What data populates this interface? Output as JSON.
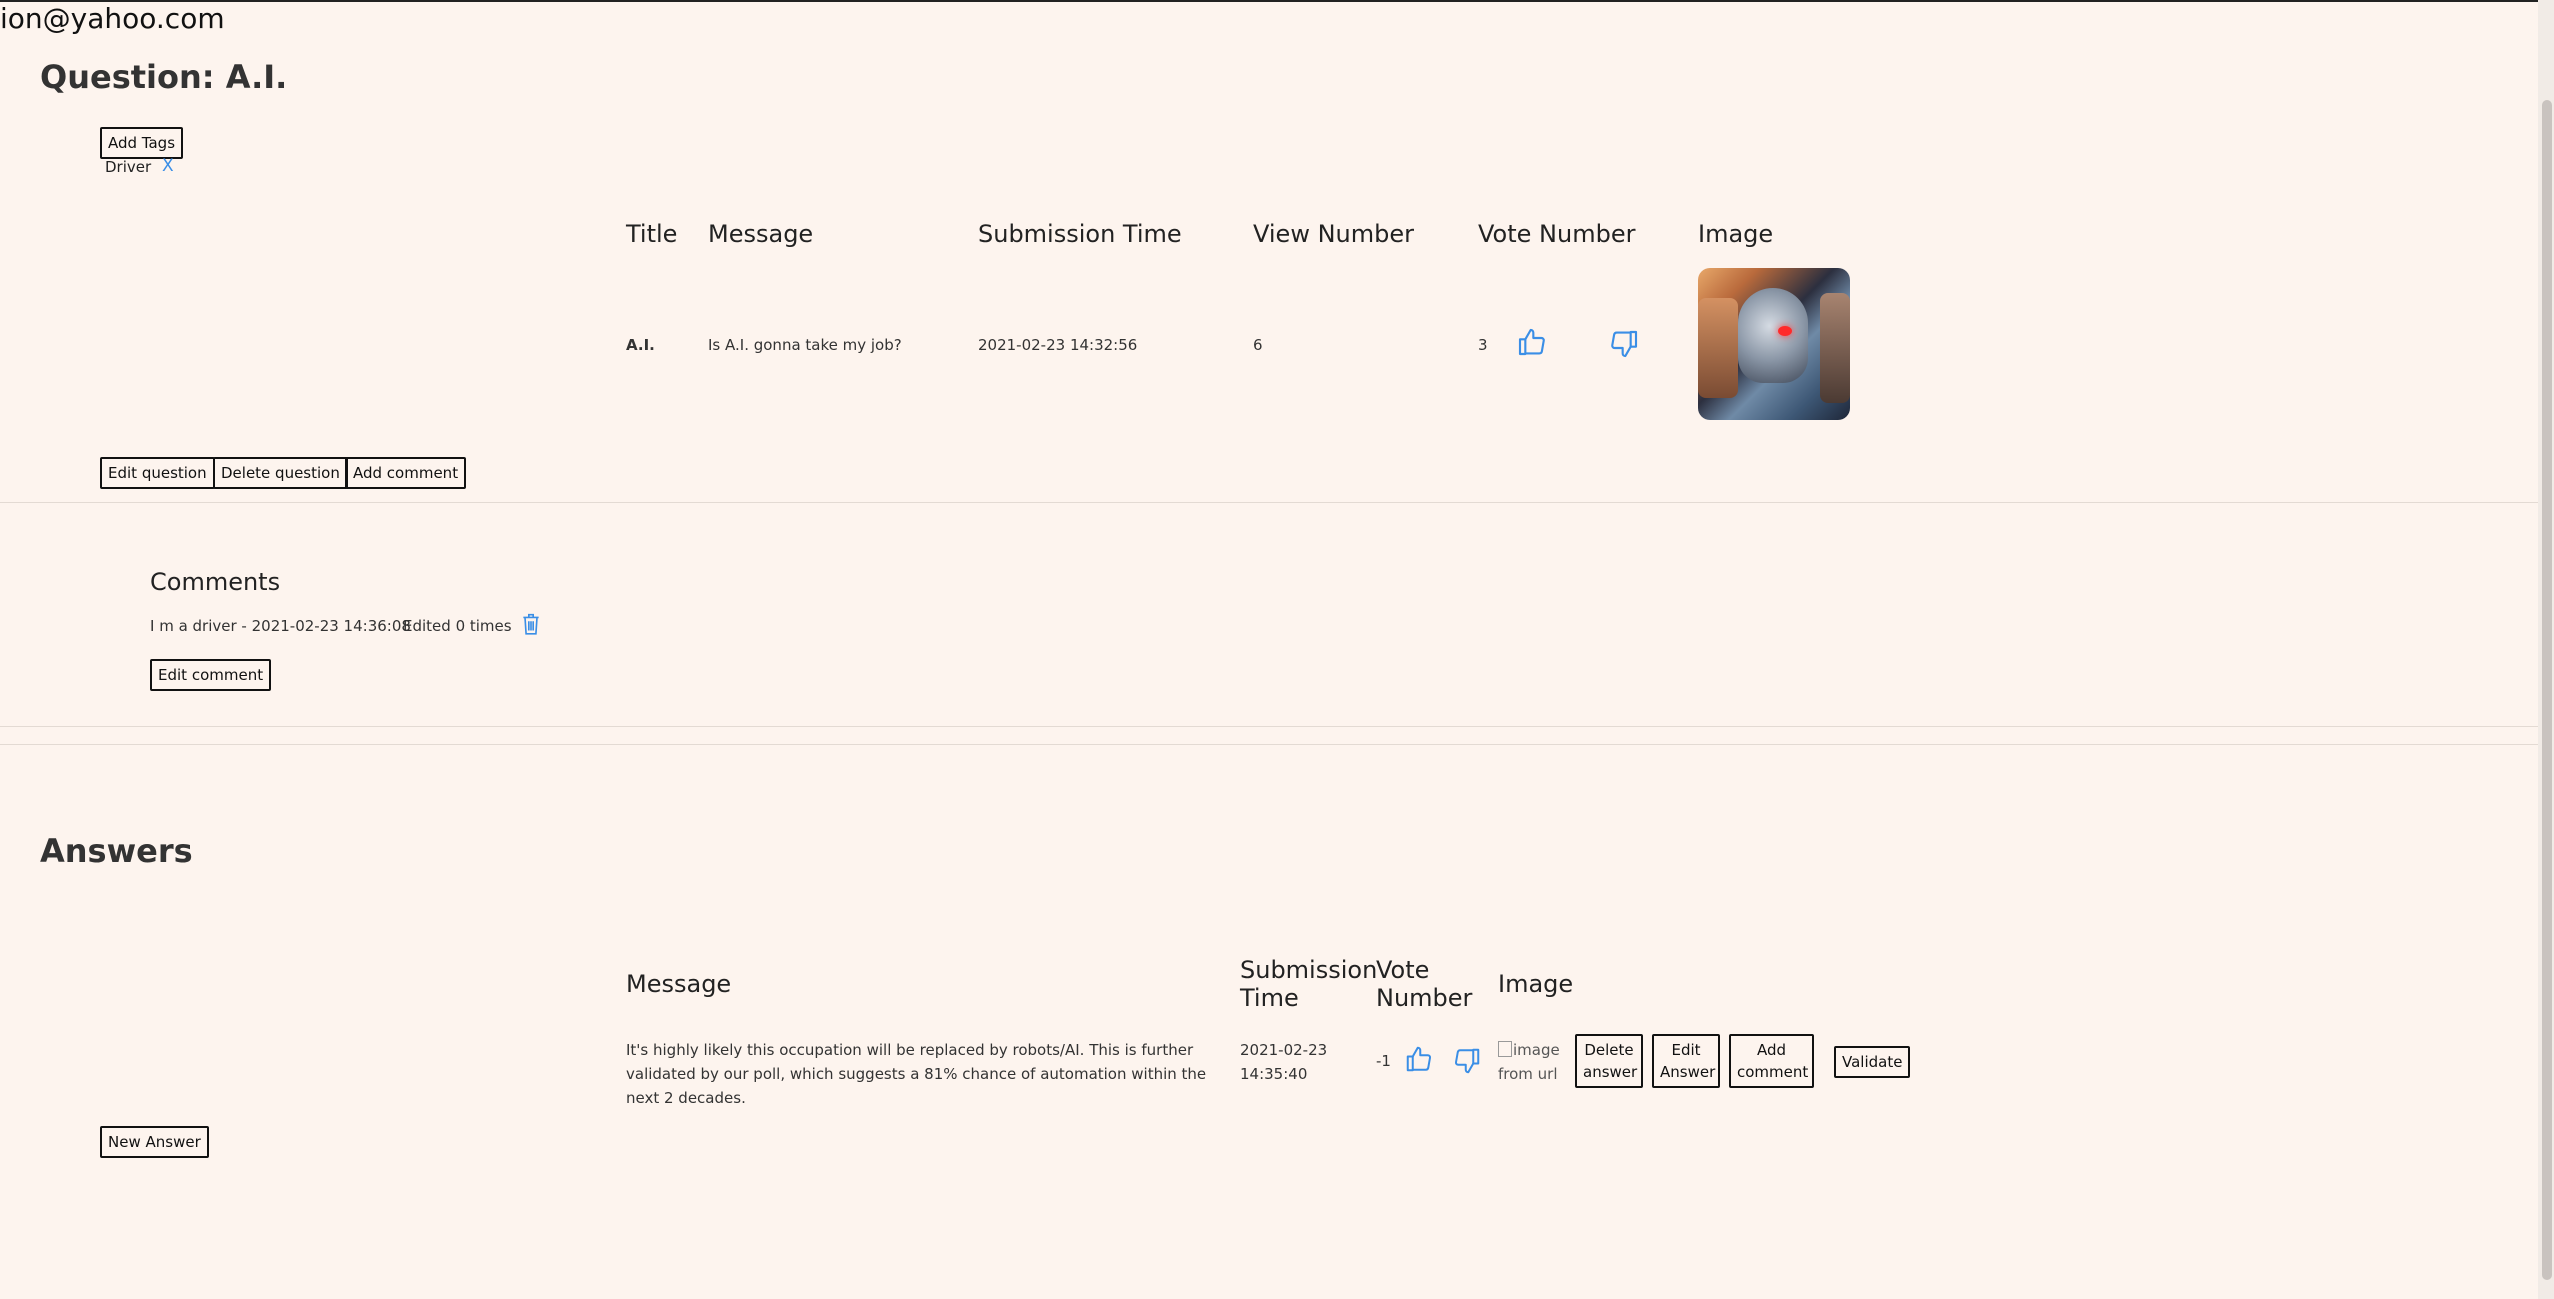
{
  "user": {
    "email": "ion@yahoo.com"
  },
  "question": {
    "heading": "Question: A.I.",
    "add_tags_label": "Add Tags",
    "tags": [
      {
        "name": "Driver",
        "remove_label": "X"
      }
    ],
    "columns": [
      "Title",
      "Message",
      "Submission Time",
      "View Number",
      "Vote Number",
      "Image"
    ],
    "row": {
      "title": "A.I.",
      "message": "Is A.I. gonna take my job?",
      "submission_time": "2021-02-23 14:32:56",
      "view_number": "6",
      "vote_number": "3"
    },
    "buttons": {
      "edit": "Edit question",
      "delete": "Delete question",
      "add_comment": "Add comment"
    }
  },
  "comments": {
    "heading": "Comments",
    "items": [
      {
        "text": "I m a driver - 2021-02-23 14:36:08",
        "edited": "Edited 0 times",
        "edit_label": "Edit comment"
      }
    ]
  },
  "answers": {
    "heading": "Answers",
    "columns": {
      "message": "Message",
      "submission_time": "Submission Time",
      "vote_number": "Vote Number",
      "image": "Image"
    },
    "rows": [
      {
        "message": "It's highly likely this occupation will be replaced by robots/AI. This is further validated by our poll, which suggests a 81% chance of automation within the next 2 decades.",
        "submission_time": "2021-02-23 14:35:40",
        "vote_number": "-1",
        "image_alt": "image from url",
        "delete_label": "Delete answer",
        "edit_label": "Edit Answer",
        "add_comment_label": "Add comment",
        "validate_label": "Validate"
      }
    ],
    "new_answer_label": "New Answer"
  },
  "colors": {
    "accent": "#3a8ee6",
    "background": "#fdf4ee"
  },
  "icons": [
    "thumbs-up-icon",
    "thumbs-down-icon",
    "trash-icon"
  ]
}
